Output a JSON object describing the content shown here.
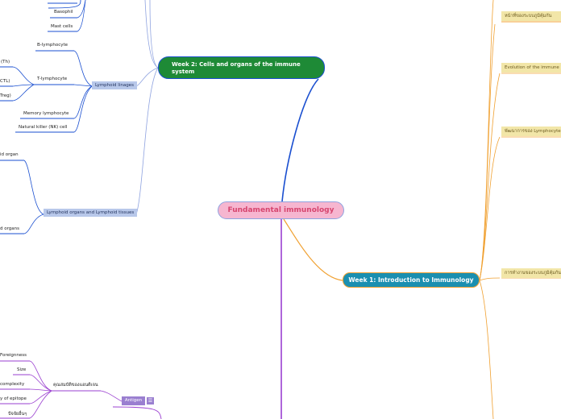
{
  "root": "Fundamental immunology",
  "week2": {
    "title": "Week 2: Cells and organs of the immune system",
    "myeloid_leaves": [
      "Basophil",
      "Mast cells"
    ],
    "lymphoid_lineages": {
      "label": "Lymphoid linages",
      "b_cell": "B-lymphocyte",
      "t_cell": {
        "label": "T-lymphocyte",
        "children": [
          "(Th)",
          "CTL)",
          "Treg)"
        ]
      },
      "memory": "Memory lymphocyte",
      "nk": "Natural killer (NK) cell"
    },
    "lymphoid_organs": {
      "label": "Lymphoid organs and Lymphoid tissues",
      "children": [
        "id organ",
        "d organs"
      ]
    }
  },
  "week1": {
    "title": "Week 1: Introduction to Immunology",
    "topics": [
      "หน้าที่ของระบบภูมิคุ้มกัน",
      "Evolution of the immune",
      "พัฒนาการของ Lymphocyte",
      "การทำงานของระบบภูมิคุ้มกัน"
    ]
  },
  "antigen": {
    "label": "Antigen",
    "icon": "list-icon",
    "properties": {
      "label": "คุณสมบัติของแอนติเจน",
      "children": [
        "Foreignness",
        "Size",
        "complexity",
        "y of epitope",
        "ปัจจัยอื่นๆ"
      ]
    }
  },
  "colors": {
    "week2_branch": "#1a4fd0",
    "week1_branch": "#f0a030",
    "antigen_branch": "#9a3fd0",
    "week2_node": "#1e8a36",
    "week1_node": "#1a8fb0",
    "root_node": "#f6b6d0"
  }
}
